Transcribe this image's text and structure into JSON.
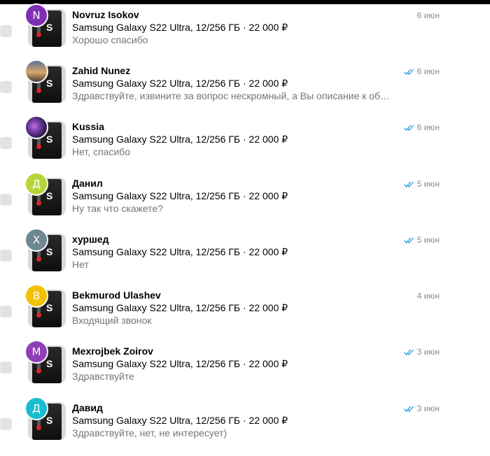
{
  "chats": [
    {
      "name": "Novruz Isokov",
      "avatar_letter": "N",
      "avatar_color": "#7f2fb5",
      "avatar_type": "letter",
      "product": "Samsung Galaxy S22 Ultra, 12/256 ГБ · 22 000 ₽",
      "message": "Хорошо спасибо",
      "date": "6 июн",
      "read": false
    },
    {
      "name": "Zahid Nunez",
      "avatar_letter": "",
      "avatar_type": "photo-sunset",
      "product": "Samsung Galaxy S22 Ultra, 12/256 ГБ · 22 000 ₽",
      "message": "Здравствуйте, извините за вопрос нескромный, а Вы описание к объявлению",
      "date": "6 июн",
      "read": true
    },
    {
      "name": "Kussia",
      "avatar_letter": "",
      "avatar_type": "photo-galaxy",
      "product": "Samsung Galaxy S22 Ultra, 12/256 ГБ · 22 000 ₽",
      "message": "Нет, спасибо",
      "date": "6 июн",
      "read": true
    },
    {
      "name": "Данил",
      "avatar_letter": "Д",
      "avatar_color": "#b5d63a",
      "avatar_type": "letter",
      "product": "Samsung Galaxy S22 Ultra, 12/256 ГБ · 22 000 ₽",
      "message": "Ну так что скажете?",
      "date": "5 июн",
      "read": true
    },
    {
      "name": "хуршед",
      "avatar_letter": "Х",
      "avatar_color": "#6e8794",
      "avatar_type": "letter",
      "product": "Samsung Galaxy S22 Ultra, 12/256 ГБ · 22 000 ₽",
      "message": "Нет",
      "date": "5 июн",
      "read": true
    },
    {
      "name": "Bekmurod Ulashev",
      "avatar_letter": "B",
      "avatar_color": "#f2c200",
      "avatar_type": "letter",
      "product": "Samsung Galaxy S22 Ultra, 12/256 ГБ · 22 000 ₽",
      "message": "Входящий звонок",
      "date": "4 июн",
      "read": false
    },
    {
      "name": "Mexrojbek Zoirov",
      "avatar_letter": "M",
      "avatar_color": "#8f3fb8",
      "avatar_type": "letter",
      "product": "Samsung Galaxy S22 Ultra, 12/256 ГБ · 22 000 ₽",
      "message": "Здравствуйте",
      "date": "3 июн",
      "read": true
    },
    {
      "name": "Давид",
      "avatar_letter": "Д",
      "avatar_color": "#19bcd0",
      "avatar_type": "letter",
      "product": "Samsung Galaxy S22 Ultra, 12/256 ГБ · 22 000 ₽",
      "message": "Здравствуйте, нет, не интересует)",
      "date": "3 июн",
      "read": true
    }
  ],
  "colors": {
    "read_check": "#1e9be6",
    "price_accent": "#000000",
    "secondary_text": "#757575"
  },
  "icons": {
    "read_receipt": "double-check-icon",
    "product_thumbnail": "phone-box-thumbnail"
  }
}
